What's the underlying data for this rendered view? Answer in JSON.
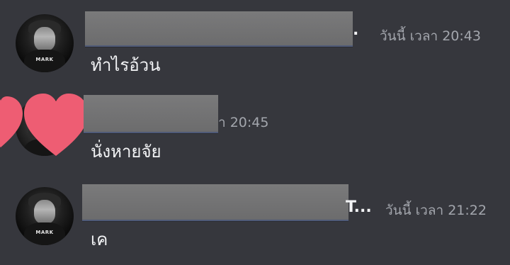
{
  "messages": [
    {
      "name_suffix": ".",
      "timestamp": "วันนี้ เวลา 20:43",
      "content": "ทำไรอ้วน",
      "avatar_text": "MARK"
    },
    {
      "name_suffix": "",
      "timestamp": "า 20:45",
      "content": "นั่งหายจัย",
      "avatar_text": ""
    },
    {
      "name_suffix": "T...",
      "timestamp": "วันนี้ เวลา 21:22",
      "content": "เค",
      "avatar_text": "MARK"
    }
  ],
  "colors": {
    "background": "#36373d",
    "text": "#f2f3f5",
    "timestamp": "#a3a6ad",
    "heart": "#ee5d73",
    "redaction": "#747475"
  }
}
